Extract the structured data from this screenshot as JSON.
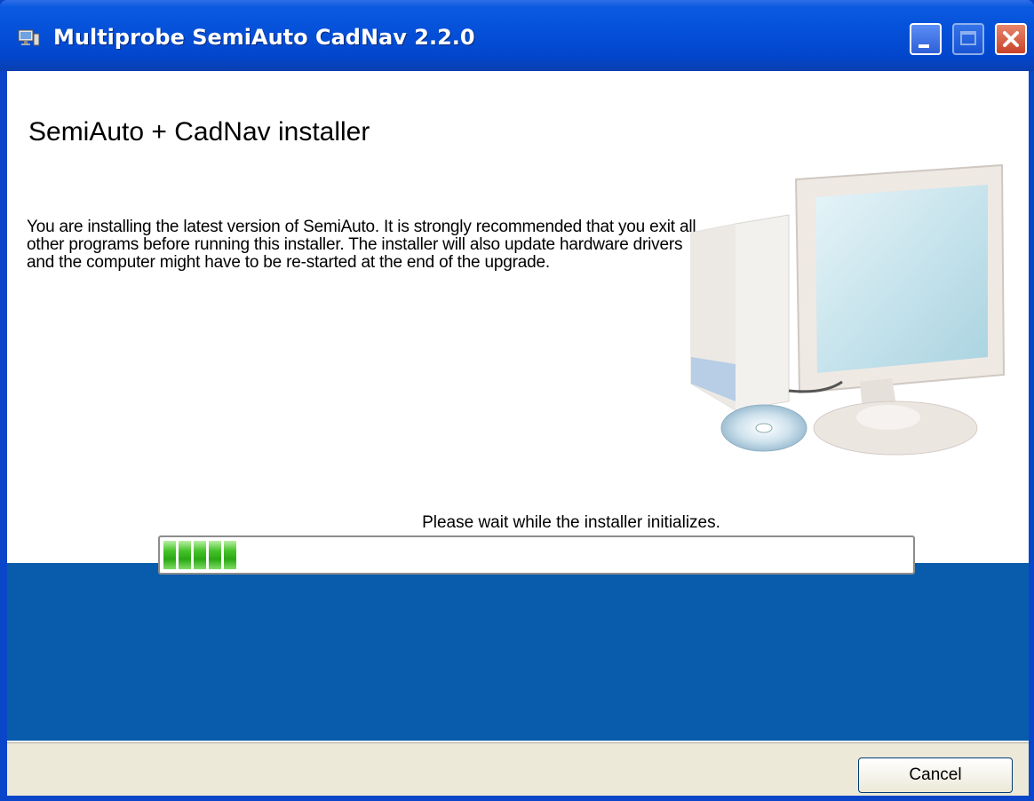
{
  "window": {
    "title": "Multiprobe SemiAuto CadNav 2.2.0",
    "app_icon": "installer-computer-icon",
    "controls": [
      "minimize-icon",
      "maximize-icon",
      "close-icon"
    ]
  },
  "main": {
    "heading": "SemiAuto + CadNav installer",
    "description": "You are installing the latest version of SemiAuto. It is strongly recommended that you exit all other programs before running this installer. The installer will also update hardware drivers and the computer might have to be re-started at the end of the upgrade.",
    "illustration": "computer-with-cd-icon"
  },
  "progress": {
    "status": "Please wait while the installer initializes.",
    "value_percent": 10,
    "fill_color": "#3db321"
  },
  "footer": {
    "cancel_label": "Cancel"
  },
  "colors": {
    "titlebar": "#0550d8",
    "band": "#095cab",
    "footer": "#ece9d8"
  }
}
